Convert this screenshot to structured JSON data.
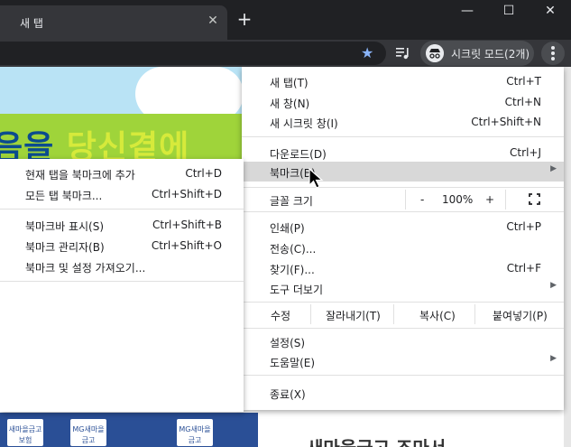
{
  "tab": {
    "title": "새 탭",
    "close": "✕",
    "new_tab": "+"
  },
  "window": {
    "minimize": "—",
    "maximize": "☐",
    "close": "✕"
  },
  "toolbar": {
    "star": "★",
    "incognito_label": "시크릿 모드(2개)"
  },
  "page": {
    "hero_prefix": "음을 ",
    "hero_highlight": "당신곁에",
    "bottom_text": "새마을금고 조마서",
    "logos": [
      "새마을금고보험",
      "MG새마을금고",
      "MG새마을금고"
    ]
  },
  "menu": {
    "items": [
      {
        "label": "새 탭(T)",
        "shortcut": "Ctrl+T"
      },
      {
        "label": "새 창(N)",
        "shortcut": "Ctrl+N"
      },
      {
        "label": "새 시크릿 창(I)",
        "shortcut": "Ctrl+Shift+N"
      },
      {
        "label": "다운로드(D)",
        "shortcut": "Ctrl+J"
      },
      {
        "label": "북마크(B)",
        "shortcut": ""
      },
      {
        "label": "인쇄(P)",
        "shortcut": "Ctrl+P"
      },
      {
        "label": "전송(C)...",
        "shortcut": ""
      },
      {
        "label": "찾기(F)...",
        "shortcut": "Ctrl+F"
      },
      {
        "label": "도구 더보기",
        "shortcut": ""
      },
      {
        "label": "설정(S)",
        "shortcut": ""
      },
      {
        "label": "도움말(E)",
        "shortcut": ""
      },
      {
        "label": "종료(X)",
        "shortcut": ""
      }
    ],
    "zoom": {
      "label": "글꼴 크기",
      "minus": "-",
      "value": "100%",
      "plus": "+"
    },
    "edit": {
      "label": "수정",
      "cut": "잘라내기(T)",
      "copy": "복사(C)",
      "paste": "붙여넣기(P)"
    }
  },
  "bookmarks_submenu": {
    "items": [
      {
        "label": "현재 탭을 북마크에 추가",
        "shortcut": "Ctrl+D"
      },
      {
        "label": "모든 탭 북마크...",
        "shortcut": "Ctrl+Shift+D"
      },
      {
        "label": "북마크바 표시(S)",
        "shortcut": "Ctrl+Shift+B"
      },
      {
        "label": "북마크 관리자(B)",
        "shortcut": "Ctrl+Shift+O"
      },
      {
        "label": "북마크 및 설정 가져오기...",
        "shortcut": ""
      }
    ]
  },
  "colors": {
    "accent": "#8ab4f8",
    "highlight": "#d8d8d8"
  }
}
